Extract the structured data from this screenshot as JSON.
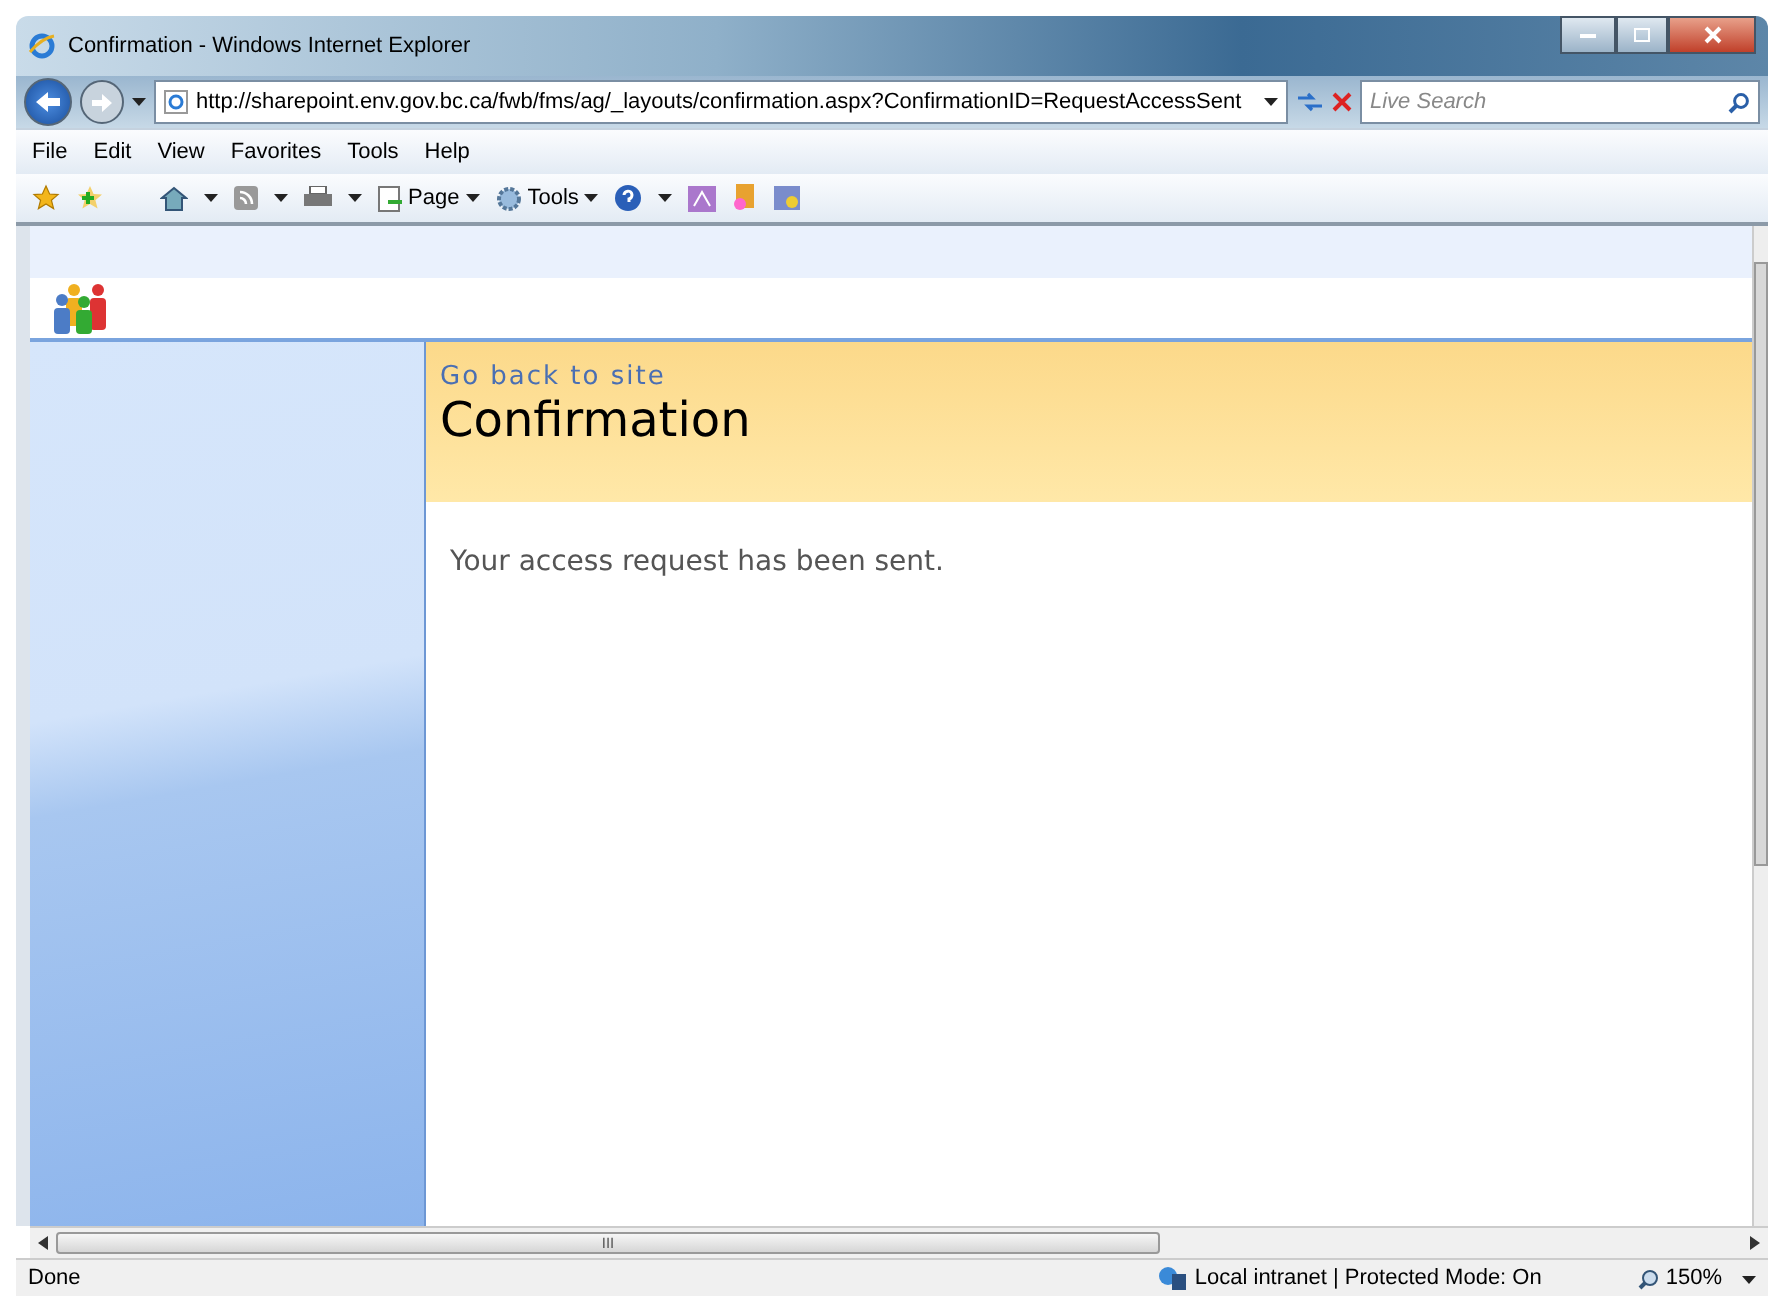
{
  "window": {
    "title": "Confirmation - Windows Internet Explorer"
  },
  "address_bar": {
    "url": "http://sharepoint.env.gov.bc.ca/fwb/fms/ag/_layouts/confirmation.aspx?ConfirmationID=RequestAccessSent"
  },
  "search": {
    "placeholder": "Live Search"
  },
  "menu": [
    "File",
    "Edit",
    "View",
    "Favorites",
    "Tools",
    "Help"
  ],
  "command_bar": [
    {
      "label": "Page"
    },
    {
      "label": "Tools"
    }
  ],
  "page": {
    "back_link": "Go back to site",
    "title": "Confirmation",
    "message": "Your access request has been sent."
  },
  "scrollbar_grip": "III",
  "status_bar": {
    "text": "Done",
    "zone": "Local intranet | Protected Mode: On",
    "zoom": "150%"
  }
}
